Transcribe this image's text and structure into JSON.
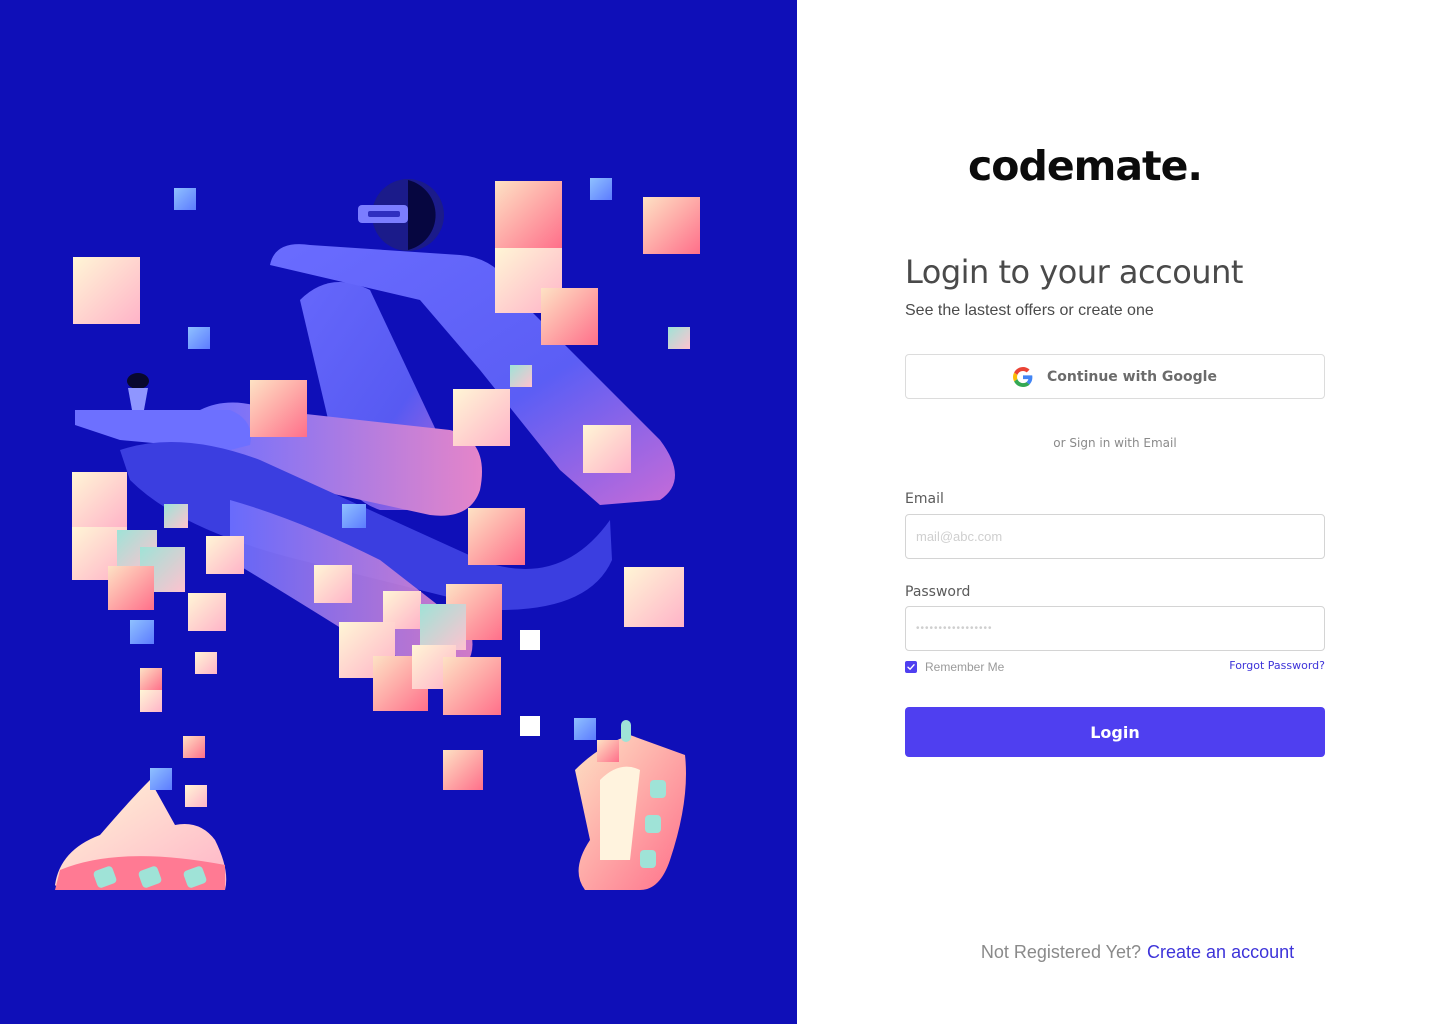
{
  "brand": {
    "logo_text": "codemate.",
    "accent_color": "#4f3ff0",
    "link_color": "#3d33d9",
    "panel_color": "#0f0fb8"
  },
  "login": {
    "title": "Login to your account",
    "subtitle": "See the lastest offers or create one",
    "google_button": {
      "label": "Continue with Google",
      "icon": "google-g-icon"
    },
    "divider": "or Sign in with Email",
    "email": {
      "label": "Email",
      "placeholder": "mail@abc.com",
      "value": ""
    },
    "password": {
      "label": "Password",
      "placeholder": "•••••••••••••••••",
      "value": ""
    },
    "remember_me": {
      "label": "Remember Me",
      "checked": true
    },
    "forgot_password": "Forgot Password?",
    "submit_label": "Login"
  },
  "footer": {
    "prompt": "Not Registered Yet?",
    "link": "Create an account"
  },
  "illustration": {
    "subject": "person-running-illustration"
  }
}
